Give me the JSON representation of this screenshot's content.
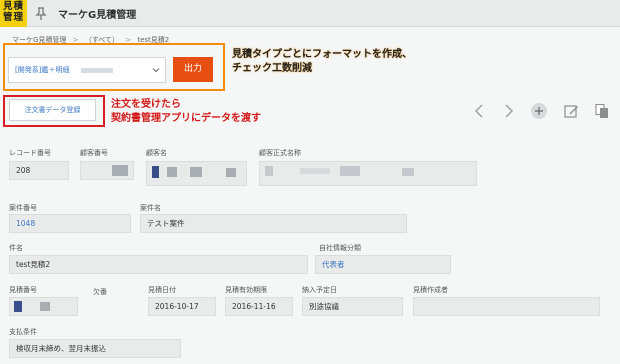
{
  "app": {
    "icon_text": "見積\n管理",
    "title": "マーケG見積管理"
  },
  "breadcrumb": [
    "マーケG見積管理",
    ">",
    "（すべて）",
    ">",
    "test見積2"
  ],
  "controls": {
    "format_select_value": "[開発系]鑑＋明細",
    "output_button": "出力",
    "order_button": "注文書データ登録"
  },
  "annotations": {
    "orange_note_line1": "見積タイプごとにフォーマットを作成、",
    "orange_note_line2": "チェック工数削減",
    "red_note_line1": "注文を受けたら",
    "red_note_line2": "契約書管理アプリにデータを渡す"
  },
  "record": {
    "record_no_label": "レコード番号",
    "record_no": "208",
    "customer_no_label": "顧客番号",
    "customer_name_label": "顧客名",
    "customer_official_label": "顧客正式名称",
    "project_no_label": "案件番号",
    "project_no": "1048",
    "project_name_label": "案件名",
    "project_name": "テスト案件",
    "subject_label": "件名",
    "subject": "test見積2",
    "company_info_label": "自社情報分類",
    "company_info": "代表者",
    "estimate_no_label": "見積番号",
    "branch_no_label": "欠番",
    "estimate_date_label": "見積日付",
    "estimate_date": "2016-10-17",
    "valid_until_label": "見積有効期限",
    "valid_until": "2016-11-16",
    "delivery_label": "納入予定日",
    "delivery": "別途協議",
    "author_label": "見積作成者",
    "payment_label": "支払条件",
    "payment": "検収月末締め、翌月末振込"
  },
  "colors": {
    "accent_orange": "#e74e12",
    "annotation_orange": "#f28c0b",
    "annotation_red": "#d81f26",
    "link_blue": "#3b78c4",
    "app_icon_yellow": "#f2d10f"
  }
}
